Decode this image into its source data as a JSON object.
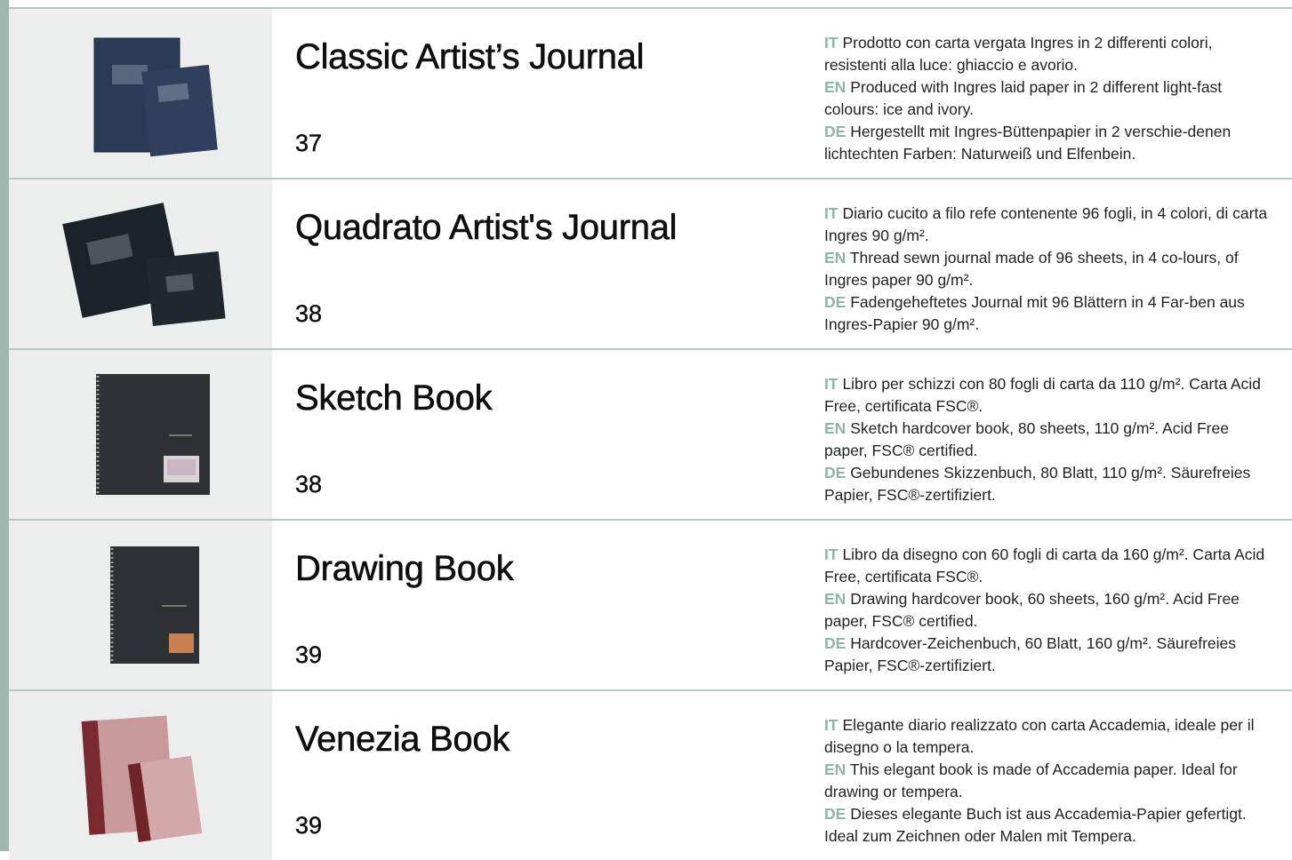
{
  "colors": {
    "accent": "#9fb6ae",
    "lang_code": "#8fb5a8"
  },
  "products": [
    {
      "title": "Classic Artist’s Journal",
      "page": "37",
      "image_icon": "navy-journals-image",
      "desc": [
        {
          "lang": "IT",
          "text": "Prodotto con carta vergata Ingres in 2 differenti colori, resistenti alla luce: ghiaccio e avorio."
        },
        {
          "lang": "EN",
          "text": "Produced with Ingres laid paper in 2 different light-fast colours: ice and ivory."
        },
        {
          "lang": "DE",
          "text": "Hergestellt mit Ingres-Büttenpapier in 2 verschie-denen lichtechten Farben: Naturweiß und Elfenbein."
        }
      ]
    },
    {
      "title": "Quadrato Artist's Journal",
      "page": "38",
      "image_icon": "black-square-journals-image",
      "desc": [
        {
          "lang": "IT",
          "text": "Diario cucito a filo refe contenente 96 fogli, in 4 colori, di carta Ingres 90 g/m²."
        },
        {
          "lang": "EN",
          "text": "Thread sewn journal made of 96 sheets, in 4 co-lours, of Ingres paper 90 g/m²."
        },
        {
          "lang": "DE",
          "text": "Fadengeheftetes Journal mit 96 Blättern in 4 Far-ben aus Ingres-Papier 90 g/m²."
        }
      ]
    },
    {
      "title": "Sketch Book",
      "page": "38",
      "image_icon": "spiral-sketchbook-image",
      "desc": [
        {
          "lang": "IT",
          "text": "Libro per schizzi con 80 fogli di carta da 110 g/m². Carta Acid Free, certificata FSC®."
        },
        {
          "lang": "EN",
          "text": "Sketch hardcover book, 80 sheets, 110 g/m². Acid Free paper, FSC® certified."
        },
        {
          "lang": "DE",
          "text": "Gebundenes Skizzenbuch, 80 Blatt, 110 g/m². Säurefreies Papier, FSC®-zertifiziert."
        }
      ]
    },
    {
      "title": "Drawing Book",
      "page": "39",
      "image_icon": "spiral-drawing-book-image",
      "desc": [
        {
          "lang": "IT",
          "text": "Libro da disegno con 60 fogli di carta da 160 g/m². Carta Acid Free, certificata FSC®."
        },
        {
          "lang": "EN",
          "text": "Drawing hardcover book, 60 sheets, 160 g/m². Acid Free paper, FSC® certified."
        },
        {
          "lang": "DE",
          "text": "Hardcover-Zeichenbuch, 60 Blatt, 160 g/m². Säurefreies Papier, FSC®-zertifiziert."
        }
      ]
    },
    {
      "title": "Venezia Book",
      "page": "39",
      "image_icon": "pink-venezia-books-image",
      "desc": [
        {
          "lang": "IT",
          "text": "Elegante diario realizzato con carta Accademia, ideale per il disegno o la tempera."
        },
        {
          "lang": "EN",
          "text": "This elegant book is made of Accademia paper. Ideal for drawing or tempera."
        },
        {
          "lang": "DE",
          "text": "Dieses elegante Buch ist aus Accademia-Papier gefertigt. Ideal zum Zeichnen oder Malen mit Tempera."
        }
      ]
    }
  ]
}
